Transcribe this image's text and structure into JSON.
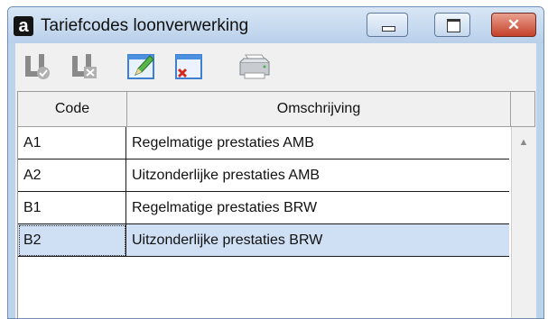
{
  "window": {
    "app_icon_letter": "a",
    "title": "Tariefcodes loonverwerking",
    "close_glyph": "✕"
  },
  "toolbar": {
    "buttons": [
      {
        "icon": "save-disabled-icon",
        "enabled": false
      },
      {
        "icon": "cancel-disabled-icon",
        "enabled": false
      },
      {
        "icon": "edit-icon",
        "enabled": true
      },
      {
        "icon": "delete-icon",
        "enabled": true
      },
      {
        "icon": "printer-icon",
        "enabled": true
      }
    ]
  },
  "grid": {
    "columns": [
      "Code",
      "Omschrijving"
    ],
    "rows": [
      {
        "code": "A1",
        "description": "Regelmatige prestaties AMB"
      },
      {
        "code": "A2",
        "description": "Uitzonderlijke prestaties AMB"
      },
      {
        "code": "B1",
        "description": "Regelmatige prestaties BRW"
      },
      {
        "code": "B2",
        "description": "Uitzonderlijke prestaties BRW"
      }
    ],
    "selected_row": 3,
    "scroll_up_glyph": "▲"
  },
  "colors": {
    "titlebar": "#c9dcf0",
    "selection": "#cfe0f4",
    "close_button": "#c5412b"
  }
}
